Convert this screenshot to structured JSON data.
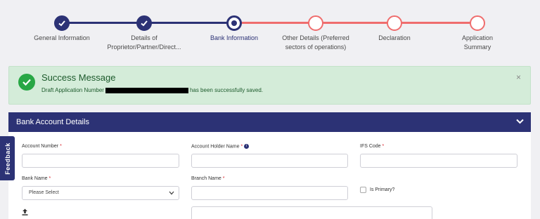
{
  "stepper": {
    "steps": [
      {
        "label": "General Information",
        "state": "done"
      },
      {
        "label": "Details of Proprietor/Partner/Direct...",
        "state": "done"
      },
      {
        "label": "Bank Information",
        "state": "active"
      },
      {
        "label": "Other Details (Preferred sectors of operations)",
        "state": "pending"
      },
      {
        "label": "Declaration",
        "state": "pending"
      },
      {
        "label": "Application Summary",
        "state": "pending"
      }
    ],
    "colors": {
      "done": "#2c3275",
      "pending": "#ef6d6d"
    }
  },
  "alert": {
    "title": "Success Message",
    "text_before": "Draft Application Number",
    "text_after": "has been successfully saved.",
    "close": "×"
  },
  "panel": {
    "title": "Bank Account Details"
  },
  "form": {
    "account_number": {
      "label": "Account Number",
      "required": "*",
      "value": ""
    },
    "account_holder_name": {
      "label": "Account Holder Name",
      "required": "*",
      "info": "i",
      "value": ""
    },
    "ifs_code": {
      "label": "IFS Code",
      "required": "*",
      "value": ""
    },
    "bank_name": {
      "label": "Bank Name",
      "required": "*",
      "selected": "Please Select"
    },
    "branch_name": {
      "label": "Branch Name",
      "required": "*",
      "value": ""
    },
    "is_primary": {
      "label": "Is Primary?",
      "checked": false
    }
  },
  "feedback": {
    "label": "Feedback"
  },
  "icons": {
    "step_done": "check-icon",
    "alert": "check-circle-icon",
    "panel_toggle": "chevron-down-icon",
    "upload": "upload-icon",
    "info": "info-icon"
  }
}
